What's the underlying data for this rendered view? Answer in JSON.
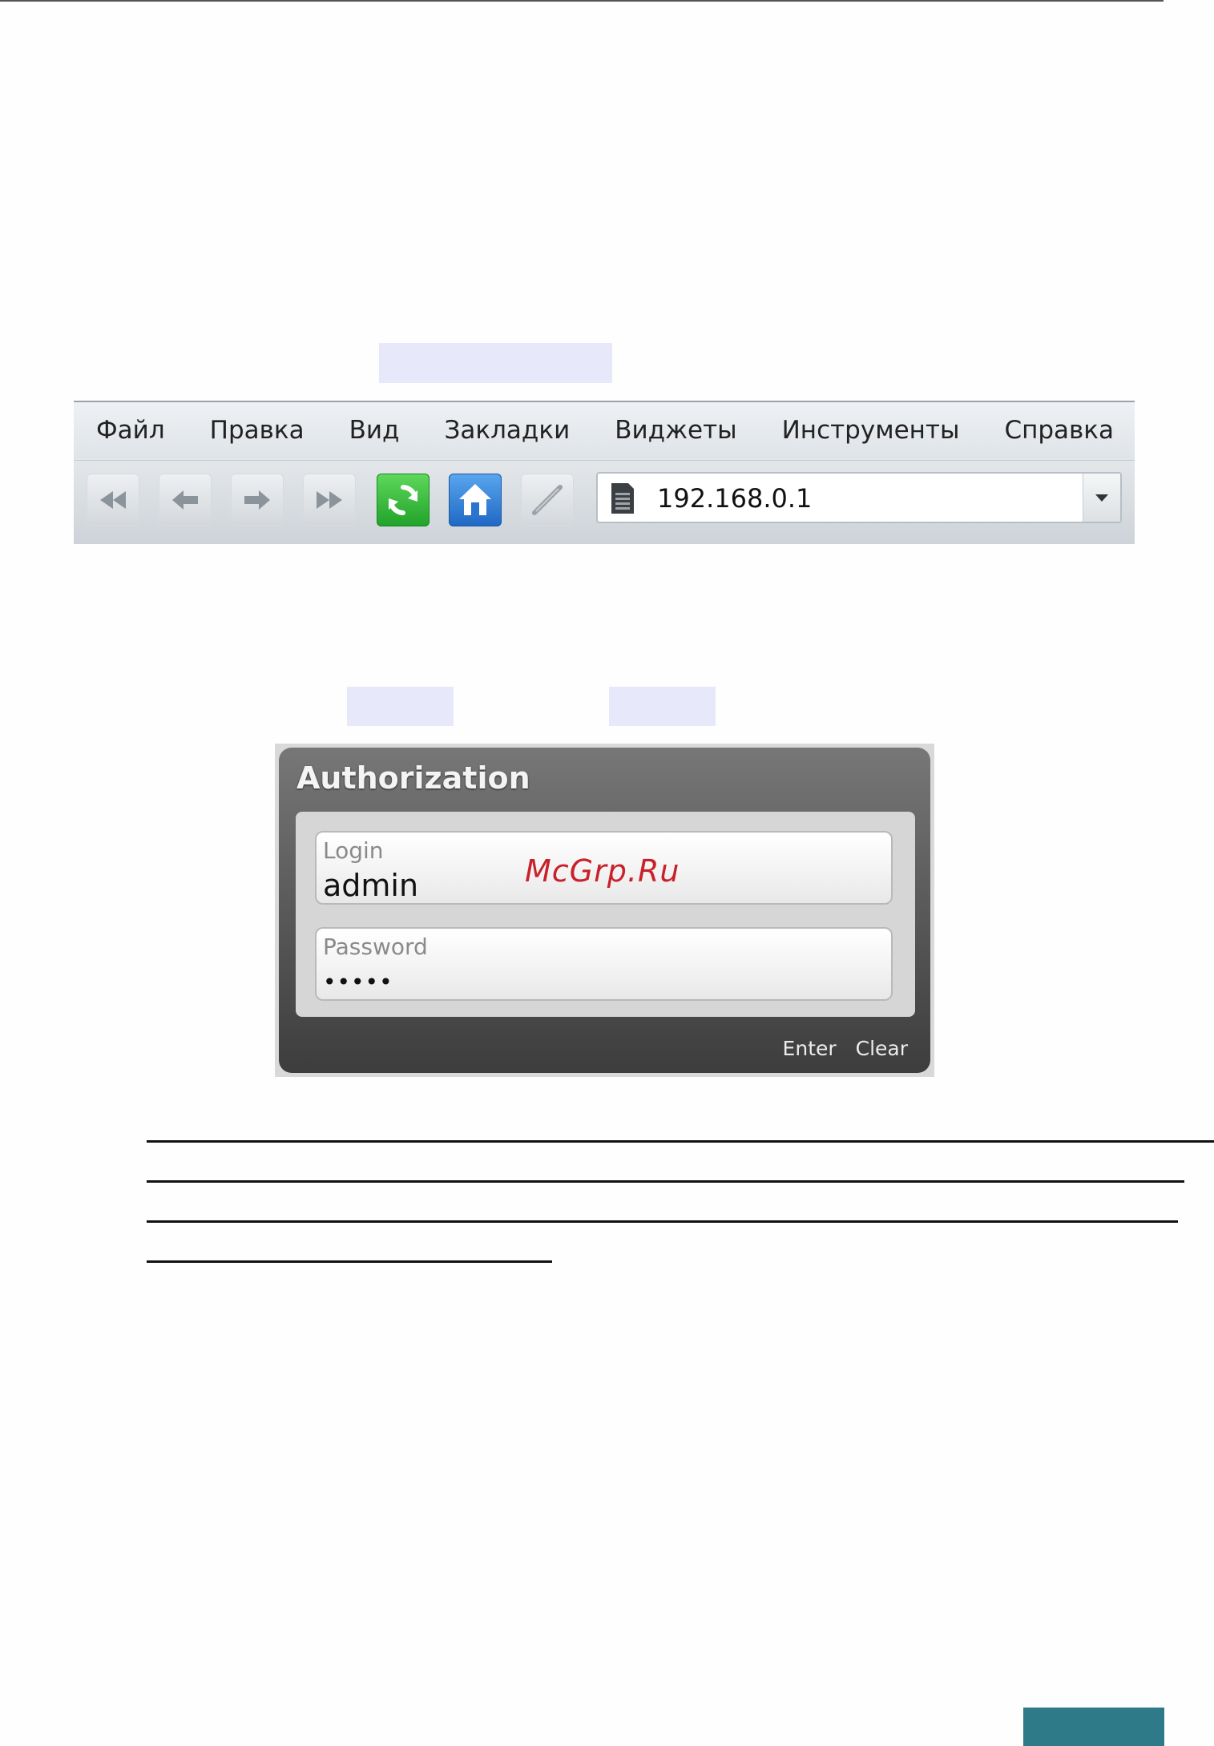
{
  "browser": {
    "menu": [
      "Файл",
      "Правка",
      "Вид",
      "Закладки",
      "Виджеты",
      "Инструменты",
      "Справка"
    ],
    "toolbar_icons": [
      "rewind-icon",
      "back-icon",
      "forward-icon",
      "fast-forward-icon",
      "reload-icon",
      "home-icon",
      "edit-icon"
    ],
    "address": {
      "url": "192.168.0.1"
    }
  },
  "auth": {
    "title": "Authorization",
    "login_label": "Login",
    "login_value": "admin",
    "password_label": "Password",
    "password_value": "•••••",
    "enter_label": "Enter",
    "clear_label": "Clear"
  },
  "watermark": "McGrp.Ru",
  "colors": {
    "highlight": "#e8e8fb",
    "reload_green": "#21a22a",
    "home_blue": "#1f68c4",
    "watermark_red": "#c9212b",
    "footer_teal": "#2e7a88"
  }
}
